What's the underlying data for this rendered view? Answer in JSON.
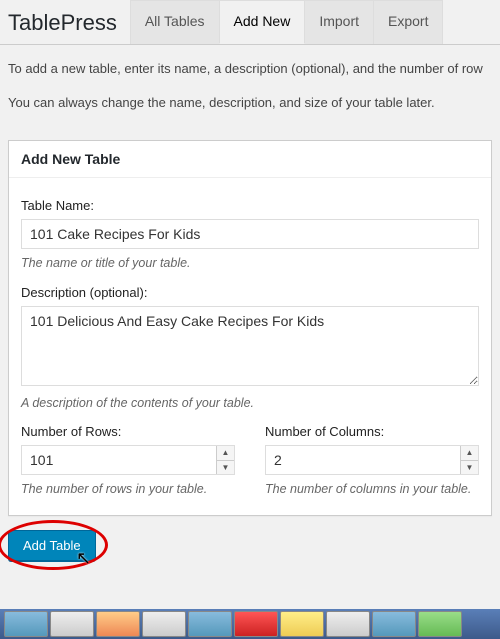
{
  "page_title": "TablePress",
  "tabs": {
    "all_tables": "All Tables",
    "add_new": "Add New",
    "import": "Import",
    "export": "Export"
  },
  "intro": {
    "line1": "To add a new table, enter its name, a description (optional), and the number of row",
    "line2": "You can always change the name, description, and size of your table later."
  },
  "metabox": {
    "title": "Add New Table",
    "name_label": "Table Name:",
    "name_value": "101 Cake Recipes For Kids",
    "name_hint": "The name or title of your table.",
    "desc_label": "Description (optional):",
    "desc_value": "101 Delicious And Easy Cake Recipes For Kids",
    "desc_hint": "A description of the contents of your table.",
    "rows_label": "Number of Rows:",
    "rows_value": "101",
    "rows_hint": "The number of rows in your table.",
    "cols_label": "Number of Columns:",
    "cols_value": "2",
    "cols_hint": "The number of columns in your table."
  },
  "submit_label": "Add Table"
}
